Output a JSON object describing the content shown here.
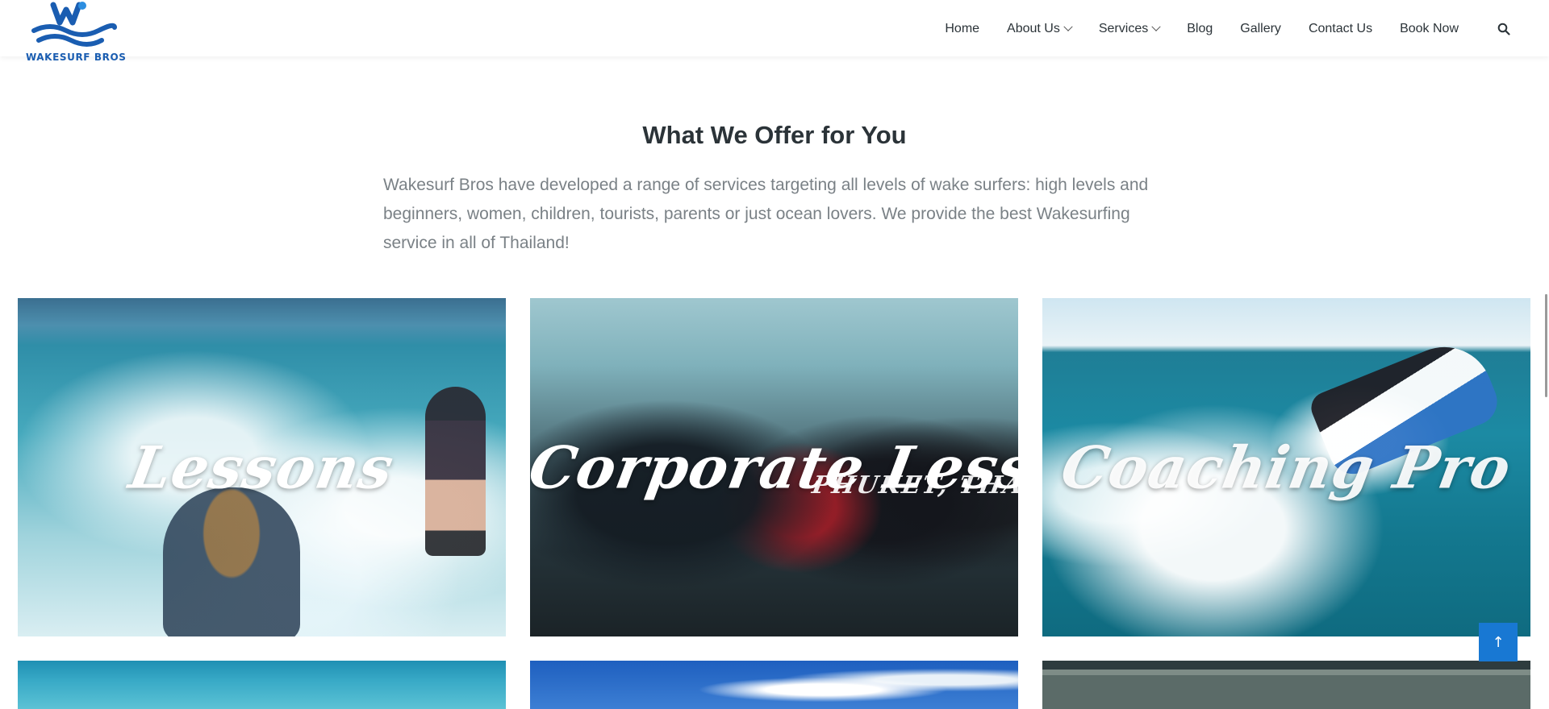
{
  "header": {
    "logo_text": "WAKESURF BROS",
    "nav": [
      {
        "label": "Home",
        "has_dropdown": false
      },
      {
        "label": "About Us",
        "has_dropdown": true
      },
      {
        "label": "Services",
        "has_dropdown": true
      },
      {
        "label": "Blog",
        "has_dropdown": false
      },
      {
        "label": "Gallery",
        "has_dropdown": false
      },
      {
        "label": "Contact Us",
        "has_dropdown": false
      },
      {
        "label": "Book Now",
        "has_dropdown": false
      }
    ],
    "search_icon": "search-icon"
  },
  "intro": {
    "title": "What We Offer for You",
    "description": "Wakesurf Bros have developed a range of services targeting all levels of wake surfers: high levels and beginners, women, children, tourists, parents or just ocean lovers. We provide the best Wakesurfing service in all of Thailand!"
  },
  "cards": [
    {
      "title": "Lessons"
    },
    {
      "title": "Corporate Lessons",
      "overlay_text": "PHUKET, THAILA"
    },
    {
      "title": "Coaching Pro"
    }
  ],
  "scroll_top": {
    "label": "↑",
    "icon": "arrow-up-icon"
  },
  "colors": {
    "brand_blue": "#1a5db1",
    "accent_blue": "#1878d3",
    "heading": "#2b3338",
    "body_text": "#7a8186"
  }
}
